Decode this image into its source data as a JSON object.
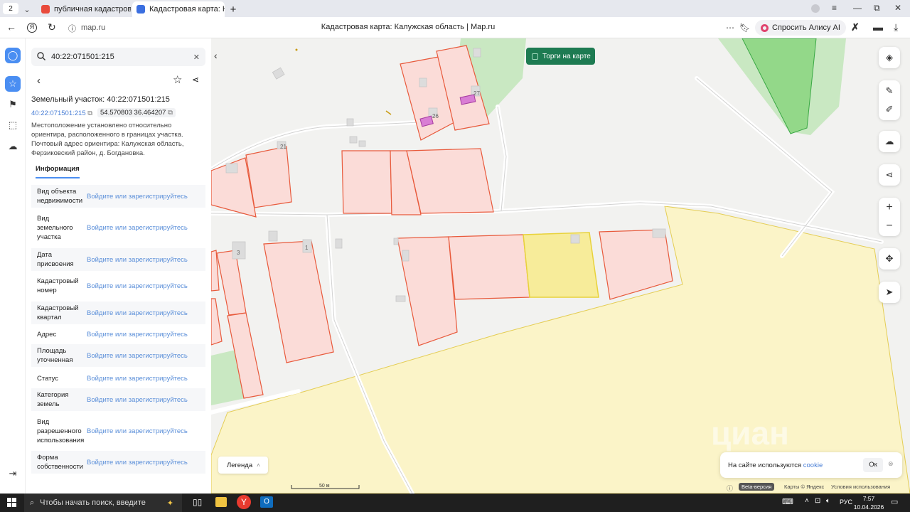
{
  "browser": {
    "tab_counter": "2",
    "tabs": [
      {
        "title": "публичная кадастровая к",
        "active": false
      },
      {
        "title": "Кадастровая карта: Ка",
        "active": true
      }
    ],
    "new_tab": "+",
    "url": "map.ru",
    "page_title": "Кадастровая карта: Калужская область | Map.ru",
    "alice_label": "Спросить Алису AI"
  },
  "panel": {
    "search_value": "40:22:071501:215",
    "heading": "Земельный участок: 40:22:071501:215",
    "cadastral_number": "40:22:071501:215",
    "coordinates": "54.570803 36.464207",
    "description": "Местоположение установлено относительно ориентира, расположенного в границах участка. Почтовый адрес ориентира: Калужская область, Ферзиковский район, д. Богдановка.",
    "tab_info": "Информация",
    "rows": [
      {
        "label": "Вид объекта недвижимости",
        "value": "Войдите или зарегистрируйтесь"
      },
      {
        "label": "Вид земельного участка",
        "value": "Войдите или зарегистрируйтесь"
      },
      {
        "label": "Дата присвоения",
        "value": "Войдите или зарегистрируйтесь"
      },
      {
        "label": "Кадастровый номер",
        "value": "Войдите или зарегистрируйтесь"
      },
      {
        "label": "Кадастровый квартал",
        "value": "Войдите или зарегистрируйтесь"
      },
      {
        "label": "Адрес",
        "value": "Войдите или зарегистрируйтесь"
      },
      {
        "label": "Площадь уточненная",
        "value": "Войдите или зарегистрируйтесь"
      },
      {
        "label": "Статус",
        "value": "Войдите или зарегистрируйтесь"
      },
      {
        "label": "Категория земель",
        "value": "Войдите или зарегистрируйтесь"
      },
      {
        "label": "Вид разрешенного использования",
        "value": "Войдите или зарегистрируйтесь"
      },
      {
        "label": "Форма собственности",
        "value": "Войдите или зарегистрируйтесь"
      }
    ]
  },
  "map": {
    "torgi_label": "Торги на карте",
    "legend_label": "Легенда",
    "scale_label": "50 м",
    "parcel_numbers": [
      "27",
      "26",
      "21",
      "3",
      "1"
    ],
    "watermark": "циан",
    "cookie_text": "На сайте используются",
    "cookie_link": "cookie",
    "cookie_ok": "Ок",
    "beta": "Beta-версия",
    "copyright": "Карты © Яндекс",
    "terms": "Условия использования",
    "colors": {
      "parcel_fill": "#fbdcd8",
      "parcel_stroke": "#e85a3c",
      "selected_fill": "#f7ec9a",
      "zone_fill": "#fbf4c8",
      "forest": "#c9e8c2",
      "torgi_bg": "#1e7b52"
    }
  },
  "taskbar": {
    "search_placeholder": "Чтобы начать поиск, введите",
    "language": "РУС",
    "time": "7:57",
    "date": "10.04.2026"
  }
}
